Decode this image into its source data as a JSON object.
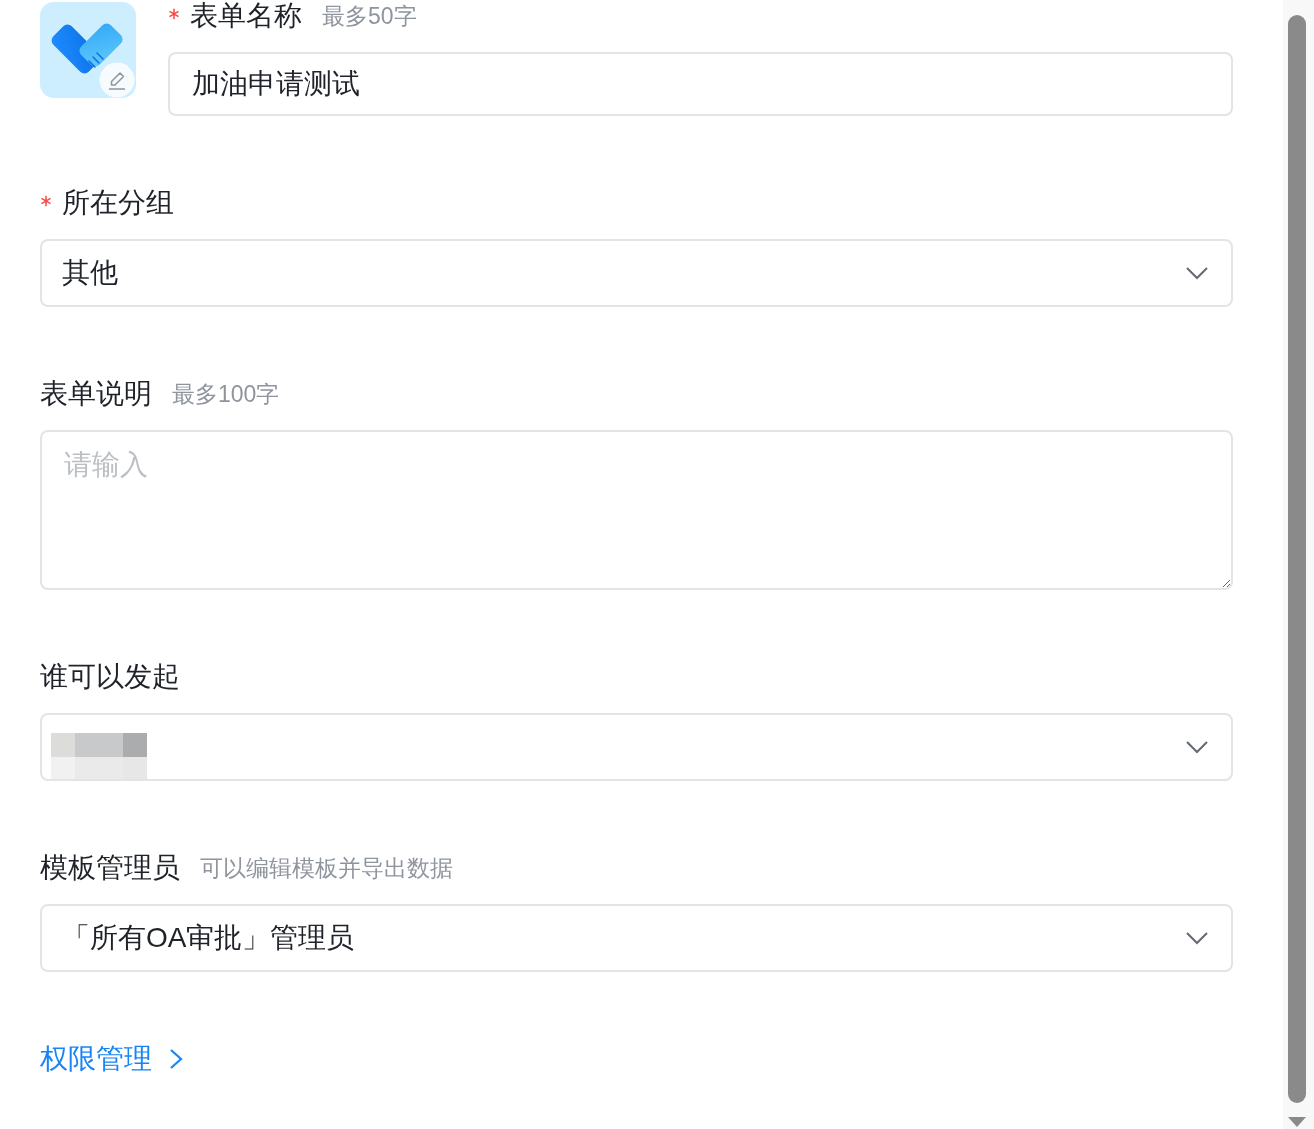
{
  "form_name": {
    "label": "表单名称",
    "required": true,
    "hint": "最多50字",
    "value": "加油申请测试"
  },
  "fields": [
    {
      "kind": "select",
      "label": "所在分组",
      "required": true,
      "value": "其他"
    },
    {
      "kind": "textarea",
      "label": "表单说明",
      "required": false,
      "hint": "最多100字",
      "placeholder": "请输入"
    },
    {
      "kind": "select",
      "label": "谁可以发起",
      "required": false,
      "redacted": true
    },
    {
      "kind": "select",
      "label": "模板管理员",
      "required": false,
      "hint": "可以编辑模板并导出数据",
      "value": "「所有OA审批」管理员"
    }
  ],
  "permission_link": {
    "label": "权限管理"
  }
}
